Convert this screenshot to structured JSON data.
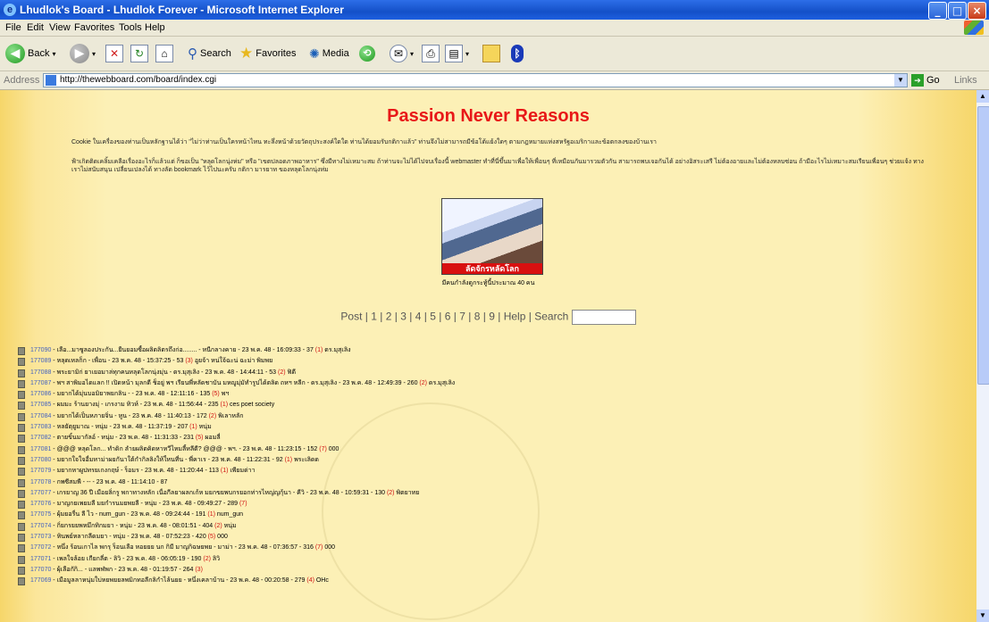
{
  "window": {
    "title": "Lhudlok's Board - Lhudlok Forever - Microsoft Internet Explorer"
  },
  "menu": [
    "File",
    "Edit",
    "View",
    "Favorites",
    "Tools",
    "Help"
  ],
  "toolbar": {
    "back": "Back",
    "search": "Search",
    "favorites": "Favorites",
    "media": "Media"
  },
  "address": {
    "label": "Address",
    "url": "http://thewebboard.com/board/index.cgi",
    "go": "Go",
    "links": "Links"
  },
  "page": {
    "title": "Passion Never Reasons",
    "intro1": "Cookie ในเครื่องของท่านเป็นหลักฐานได้ว่า \"ไม่ว่าท่านเป็นใครหน้าไหน ทะลึ่งหน้าด้วยวัตถุประสงค์ใดใด ท่านได้ยอมรับกติกาแล้ว\" ท่านจึงไม่สามารถมีข้อโต้แย้งใดๆ ตามกฎหมายแห่งสหรัฐอเมริกาและข้อตกลงของบ้านเรา",
    "intro2": "ฟ้าเกิดติดเคลิ้มเคลือเรื่องอะไรก็แล้วแต่ ก็ขอเป็น \"หลุดโลกนุ่งห่ม\" หรือ \"เขตปลอดภาพอาหาร\" ซึ่งมีทางไม่เหมาะสม ถ้าท่านจะไม่ได้ไปจบเรื่องนี้ webmaster ทำที่นี่ขึ้นมาเพื่อให้เพื่อนๆ ที่เหมือนกันมารวมตัวกัน สามารถพบเจอกันได้ อย่างอิสระเสรี ไม่ต้องอายและไม่ต้องหลบซ่อน ถ้ามีอะไรไม่เหมาะสมเรียนเพื่อนๆ ช่วยแจ้ง ทางเราไม่สนับสนุน เปลี่ยนเปลงได้ ทางลัด bookmark ไว้ไปนะครับ กติกา มารยาท ของหลุดโลกนุ่งห่ม",
    "online": "มีคนกำลังดูกระทู้นี้ประมาณ 40 คน",
    "photo_banner": "ลัดจักรหลัดโลก",
    "nav": {
      "post": "Post",
      "sep": "|",
      "pages": [
        "1",
        "2",
        "3",
        "4",
        "5",
        "6",
        "7",
        "8",
        "9"
      ],
      "help": "Help",
      "search": "Search"
    }
  },
  "posts": [
    {
      "id": "177090",
      "rest": " - เลือ...มาซูลองประกัน...ยืนยอมซื้อผลิตลิตรถึงก่อ........ - หนีกลางคาย - 23 พ.ค. 48 - 16:09:33 - 37 ",
      "replies": "(1)",
      "tail": " ดร.มุสุเลิง"
    },
    {
      "id": "177089",
      "rest": " - หลุดเหลก็ก - เพื่อน - 23 พ.ค. 48 - 15:37:25 - 53 ",
      "replies": "(3)",
      "tail": " อูยจ้า หน่ใจ้ฉะน่ ฉะม่า พิมพย"
    },
    {
      "id": "177088",
      "rest": " - พระยามิก่ ยาเยอมาล่ทุกคนหลุดโลกนุ่งมุ่น - ดร.มุสุเลิง - 23 พ.ค. 48 - 14:44:11 - 53 ",
      "replies": "(2)",
      "tail": " ฟิดี"
    },
    {
      "id": "177087",
      "rest": " - พฯ สาพิมอไดแลก !! เปิดหน้า มุลกดี ช็อยู่ พฯ เรียนพี่หลัดชาบัน มหญูมุ่มัทำรูปได้ตลิด ถหฯ หลีก - ดร.มุสุเลิง - 23 พ.ค. 48 - 12:49:39 - 260 ",
      "replies": "(2)",
      "tail": " ดร.มุสุเลิง"
    },
    {
      "id": "177086",
      "rest": " - มยากได้มุ่นบอมิยาพยกลิน - - 23 พ.ค. 48 - 12:11:16 - 135 ",
      "replies": "(5)",
      "tail": " พฯ"
    },
    {
      "id": "177085",
      "rest": " - ผมมะ ร้านยางมุ่ - เกรงาม ทิวห์ - 23 พ.ค. 48 - 11:56:44 - 235 ",
      "replies": "(1)",
      "tail": " ces poet society"
    },
    {
      "id": "177084",
      "rest": " - มยากได้เป็นหภายจิ่น - หูน - 23 พ.ค. 48 - 11:40:13 - 172 ",
      "replies": "(2)",
      "tail": " พิเลาหลัก"
    },
    {
      "id": "177083",
      "rest": " - หลยัตุยูมาณ - หนุ่ม - 23 พ.ค. 48 - 11:37:19 - 207 ",
      "replies": "(1)",
      "tail": " หนุ่ม"
    },
    {
      "id": "177082",
      "rest": " - ตายขิ้นมากัลอ์ - หนุ่ม - 23 พ.ค. 48 - 11:31:33 - 231 ",
      "replies": "(5)",
      "tail": " ผอมลี่"
    },
    {
      "id": "177081",
      "rest": " - @@@ หลุดโลก... ทำดิก ลำยผลิตคิดหาหวีไหมลี้หลีดี? @@@ - พฯ. - 23 พ.ค. 48 - 11:23:15 - 152 ",
      "replies": "(7)",
      "tail": " 000"
    },
    {
      "id": "177080",
      "rest": " - มยากใจใจอื่มหาม่าผยกันาใต้กำกิลลิงให้ใ่หนที่น - พี่คาเร - 23 พ.ค. 48 - 11:22:31 - 92 ",
      "replies": "(1)",
      "tail": " พระเลิดด"
    },
    {
      "id": "177079",
      "rest": " - มยากหาผูปทรยเกงกฤษ์ - ร็อมร - 23 พ.ค. 48 - 11:20:44 - 113 ",
      "replies": "(1)",
      "tail": " เพียมด่าา"
    },
    {
      "id": "177078",
      "rest": " - กพซีสมพี - -- - 23 พ.ค. 48 - 11:14:10 - 87",
      "replies": "",
      "tail": ""
    },
    {
      "id": "177077",
      "rest": " - เกรยาญ 36 ปี เมือยลิ่กรู พกาทางหลัก เนื่อกีลยาผลกเก้ห มยกขยพบกรยอกท่ารไหญ่ญกุ้นา - คีวิ - 23 พ.ค. 48 - 10:59:31 - 130 ",
      "replies": "(2)",
      "tail": " พิตยาทย"
    },
    {
      "id": "177076",
      "rest": " - มาญกยเพยมลี มยกำรนมยพยลี - หนุ่ม - 23 พ.ค. 48 - 09:49:27 - 289 ",
      "replies": "(7)",
      "tail": ""
    },
    {
      "id": "177075",
      "rest": " - ผุ้มยอรื่น ลี ไว - num_gun - 23 พ.ค. 48 - 09:24:44 - 191 ",
      "replies": "(1)",
      "tail": " num_gun"
    },
    {
      "id": "177074",
      "rest": " - กิ่ยกรยยพหมึกทิกมยา - หนุ่ม - 23 พ.ค. 48 - 08:01:51 - 404 ",
      "replies": "(2)",
      "tail": " หนุ่ม"
    },
    {
      "id": "177073",
      "rest": " - หินพย์หลากลีดมยา - หนุ่ม - 23 พ.ค. 48 - 07:52:23 - 420 ",
      "replies": "(5)",
      "tail": " 000"
    },
    {
      "id": "177072",
      "rest": " - หนึ่ง ร้อนเกาไล พกรุ ร็อนเลือ หอยยย นก กิมี มาญกิฉษยพย - มาม่า - 23 พ.ค. 48 - 07:36:57 - 316 ",
      "replies": "(7)",
      "tail": " 000"
    },
    {
      "id": "177071",
      "rest": " - เพลใจล้อย เกียกลี่ต - ลิวิ - 23 พ.ค. 48 - 06:05:19 - 190 ",
      "replies": "(2)",
      "tail": " ลิวิ"
    },
    {
      "id": "177070",
      "rest": " - ผุ้เลือกักิ... - แลพฬพก - 23 พ.ค. 48 - 01:19:57 - 264 ",
      "replies": "(3)",
      "tail": ""
    },
    {
      "id": "177069",
      "rest": " - เมือมูลลาหนุ่มใบ่หยพยยลพมิกทอลีกลิกำไล้นยย - หนึ่งเคลาบ้าน - 23 พ.ค. 48 - 00:20:58 - 279 ",
      "replies": "(4)",
      "tail": " OHc"
    }
  ]
}
